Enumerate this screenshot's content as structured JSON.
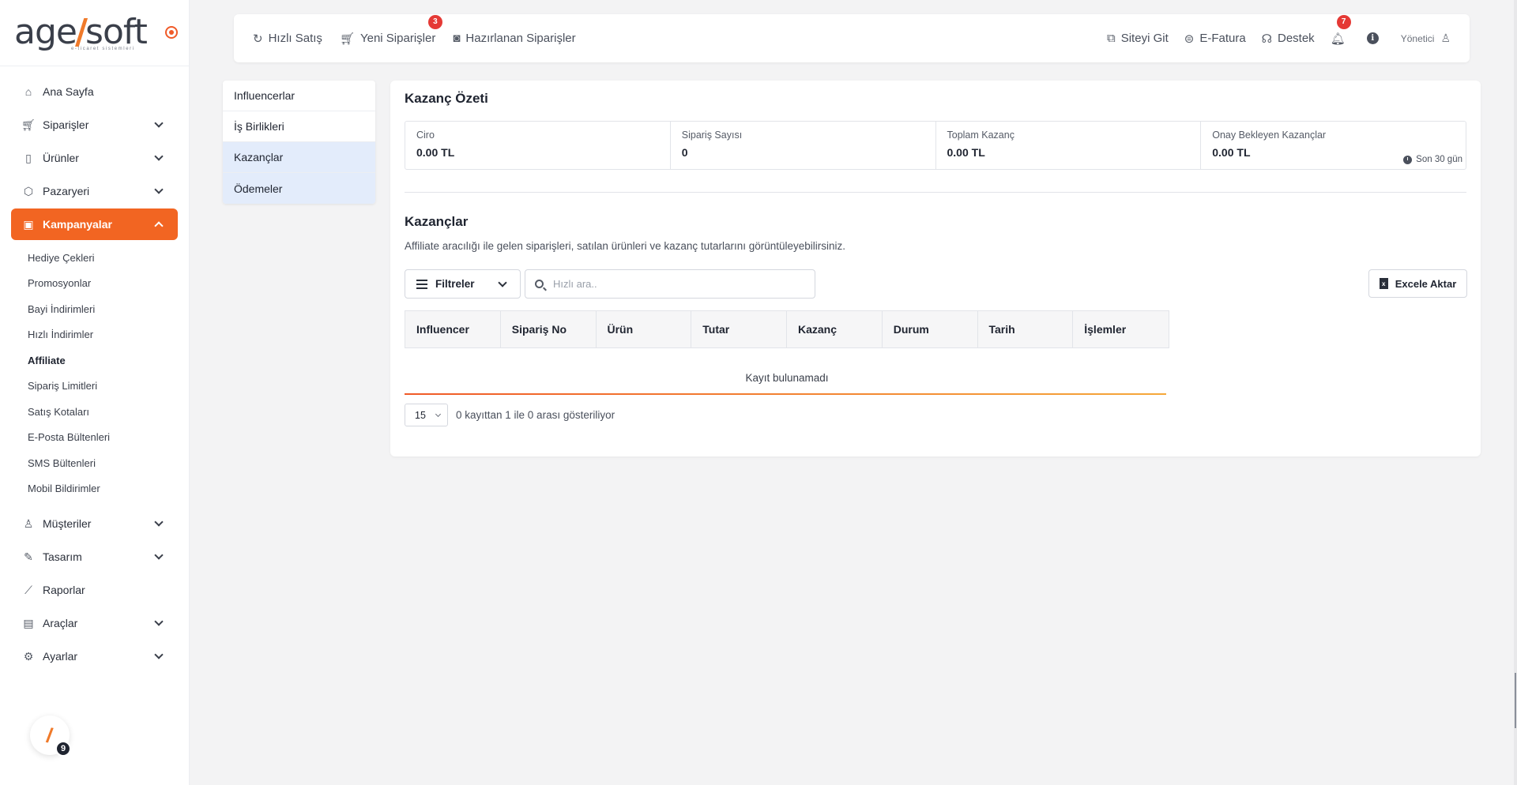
{
  "app": {
    "logo_main_left": "age",
    "logo_slash": "/",
    "logo_main_right": "soft",
    "logo_sub": "e-ticaret sistemleri",
    "help_badge": "9",
    "brand_color": "#f26522"
  },
  "sidebar": {
    "items": [
      {
        "label": "Ana Sayfa",
        "icon": "home-icon"
      },
      {
        "label": "Siparişler",
        "icon": "cart-icon"
      },
      {
        "label": "Ürünler",
        "icon": "book-icon"
      },
      {
        "label": "Pazaryeri",
        "icon": "box-icon"
      },
      {
        "label": "Kampanyalar",
        "icon": "gift-icon",
        "active": true
      },
      {
        "label": "Müşteriler",
        "icon": "user-icon"
      },
      {
        "label": "Tasarım",
        "icon": "pencil-icon"
      },
      {
        "label": "Raporlar",
        "icon": "chart-icon"
      },
      {
        "label": "Araçlar",
        "icon": "clipboard-icon"
      },
      {
        "label": "Ayarlar",
        "icon": "gear-icon"
      }
    ],
    "submenu": [
      "Hediye Çekleri",
      "Promosyonlar",
      "Bayi İndirimleri",
      "Hızlı İndirimler",
      "Affiliate",
      "Sipariş Limitleri",
      "Satış Kotaları",
      "E-Posta Bültenleri",
      "SMS Bültenleri",
      "Mobil Bildirimler"
    ],
    "selected_submenu": "Affiliate"
  },
  "topbar": {
    "quick_sale": "Hızlı Satış",
    "new_orders": "Yeni Siparişler",
    "new_orders_badge": "3",
    "prepared_orders": "Hazırlanan Siparişler",
    "go_site": "Siteyi Git",
    "einvoice": "E-Fatura",
    "support": "Destek",
    "notifications_badge": "7",
    "info": "i",
    "user": "Yönetici"
  },
  "subnav": {
    "items": [
      "Influencerlar",
      "İş Birlikleri",
      "Kazançlar",
      "Ödemeler"
    ]
  },
  "summary": {
    "title": "Kazanç Özeti",
    "stats": [
      {
        "label": "Ciro",
        "value": "0.00 TL"
      },
      {
        "label": "Sipariş Sayısı",
        "value": "0"
      },
      {
        "label": "Toplam Kazanç",
        "value": "0.00 TL"
      },
      {
        "label": "Onay Bekleyen Kazançlar",
        "value": "0.00 TL"
      }
    ],
    "period_note": "Son 30 gün"
  },
  "earnings": {
    "title": "Kazançlar",
    "description": "Affiliate aracılığı ile gelen siparişleri, satılan ürünleri ve kazanç tutarlarını görüntüleyebilirsiniz.",
    "filter_label": "Filtreler",
    "search_placeholder": "Hızlı ara..",
    "export_label": "Excele Aktar",
    "columns": [
      "Influencer",
      "Sipariş No",
      "Ürün",
      "Tutar",
      "Kazanç",
      "Durum",
      "Tarih",
      "İşlemler"
    ],
    "empty_text": "Kayıt bulunamadı",
    "page_size": "15",
    "pager_text": "0 kayıttan 1 ile 0 arası gösteriliyor"
  }
}
